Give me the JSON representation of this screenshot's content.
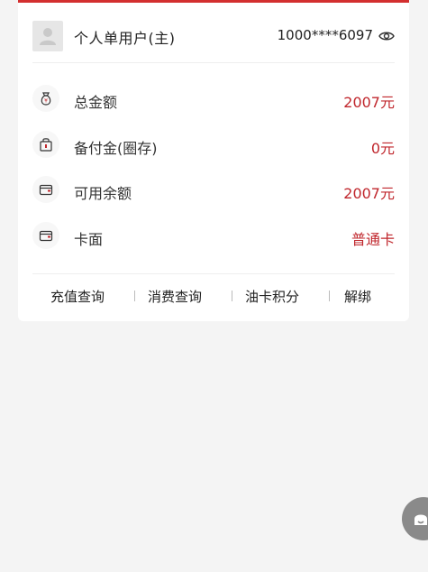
{
  "account": {
    "user_name": "个人单用户(主)",
    "card_number": "1000****6097"
  },
  "rows": [
    {
      "label": "总金额",
      "value": "2007元",
      "icon": "money-bag-icon"
    },
    {
      "label": "备付金(圈存)",
      "value": "0元",
      "icon": "lock-box-icon"
    },
    {
      "label": "可用余额",
      "value": "2007元",
      "icon": "wallet-icon"
    },
    {
      "label": "卡面",
      "value": "普通卡",
      "icon": "wallet-icon"
    }
  ],
  "actions": [
    "充值查询",
    "消费查询",
    "油卡积分",
    "解绑"
  ],
  "colors": {
    "accent": "#c0272d",
    "top_border": "#d32f2f"
  }
}
